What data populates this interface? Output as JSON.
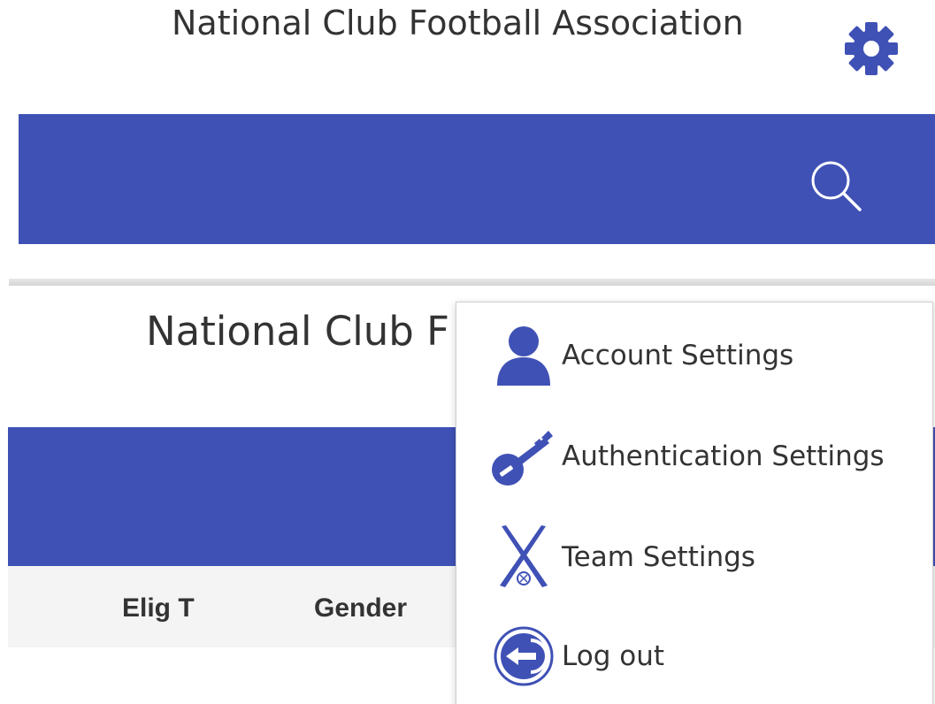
{
  "top_panel": {
    "title": "National Club Football Association",
    "settings_icon": "gear-icon",
    "search_icon": "search-icon"
  },
  "bottom_panel": {
    "title": "National Club F",
    "columns": [
      "Elig T",
      "Gender"
    ]
  },
  "menu": {
    "items": [
      {
        "label": "Account Settings",
        "icon": "user-icon"
      },
      {
        "label": "Authentication Settings",
        "icon": "key-icon"
      },
      {
        "label": "Team Settings",
        "icon": "crossed-bats-icon"
      },
      {
        "label": "Log out",
        "icon": "logout-icon"
      }
    ]
  },
  "colors": {
    "brand": "#3f51b5",
    "header_row": "#f4f4f4",
    "text": "#333333"
  }
}
